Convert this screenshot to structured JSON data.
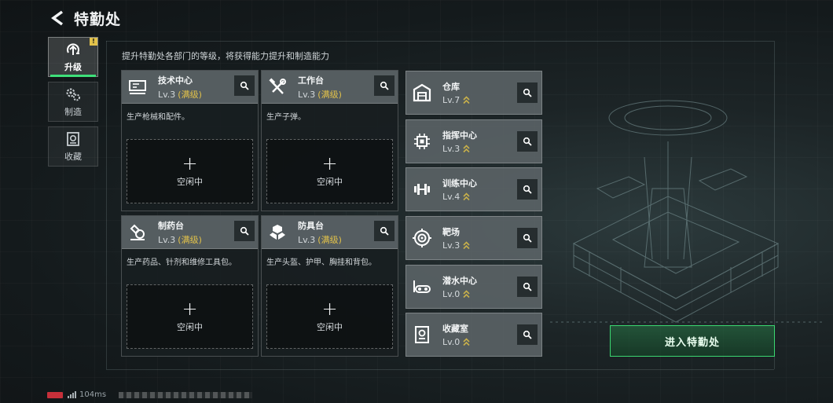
{
  "header": {
    "title": "特勤处"
  },
  "tabs": [
    {
      "label": "升级",
      "icon": "upgrade-icon",
      "active": true,
      "badge": "!"
    },
    {
      "label": "制造",
      "icon": "gears-icon",
      "active": false
    },
    {
      "label": "收藏",
      "icon": "collection-icon",
      "active": false
    }
  ],
  "hint": "提升特勤处各部门的等级，将获得能力提升和制造能力",
  "departments": [
    {
      "name": "技术中心",
      "level": "Lv.3",
      "max": "(满级)",
      "desc": "生产枪械和配件。",
      "slot": "空闲中",
      "icon": "tech-center-icon"
    },
    {
      "name": "工作台",
      "level": "Lv.3",
      "max": "(满级)",
      "desc": "生产子弹。",
      "slot": "空闲中",
      "icon": "workbench-icon"
    },
    {
      "name": "制药台",
      "level": "Lv.3",
      "max": "(满级)",
      "desc": "生产药品、针剂和维修工具包。",
      "slot": "空闲中",
      "icon": "pharmacy-icon"
    },
    {
      "name": "防具台",
      "level": "Lv.3",
      "max": "(满级)",
      "desc": "生产头盔、护甲、胸挂和背包。",
      "slot": "空闲中",
      "icon": "armor-bench-icon"
    }
  ],
  "facilities": [
    {
      "name": "仓库",
      "level": "Lv.7",
      "icon": "warehouse-icon"
    },
    {
      "name": "指挥中心",
      "level": "Lv.3",
      "icon": "command-center-icon"
    },
    {
      "name": "训练中心",
      "level": "Lv.4",
      "icon": "training-center-icon"
    },
    {
      "name": "靶场",
      "level": "Lv.3",
      "icon": "shooting-range-icon"
    },
    {
      "name": "潜水中心",
      "level": "Lv.0",
      "icon": "diving-center-icon"
    },
    {
      "name": "收藏室",
      "level": "Lv.0",
      "icon": "collection-room-icon"
    }
  ],
  "enter_button": "进入特勤处",
  "status": {
    "ping": "104ms"
  },
  "colors": {
    "accent_green": "#3ee07a",
    "max_gold": "#e2c24a",
    "upgrade_arrow": "#c8b04a",
    "battery_red": "#c6303a"
  }
}
